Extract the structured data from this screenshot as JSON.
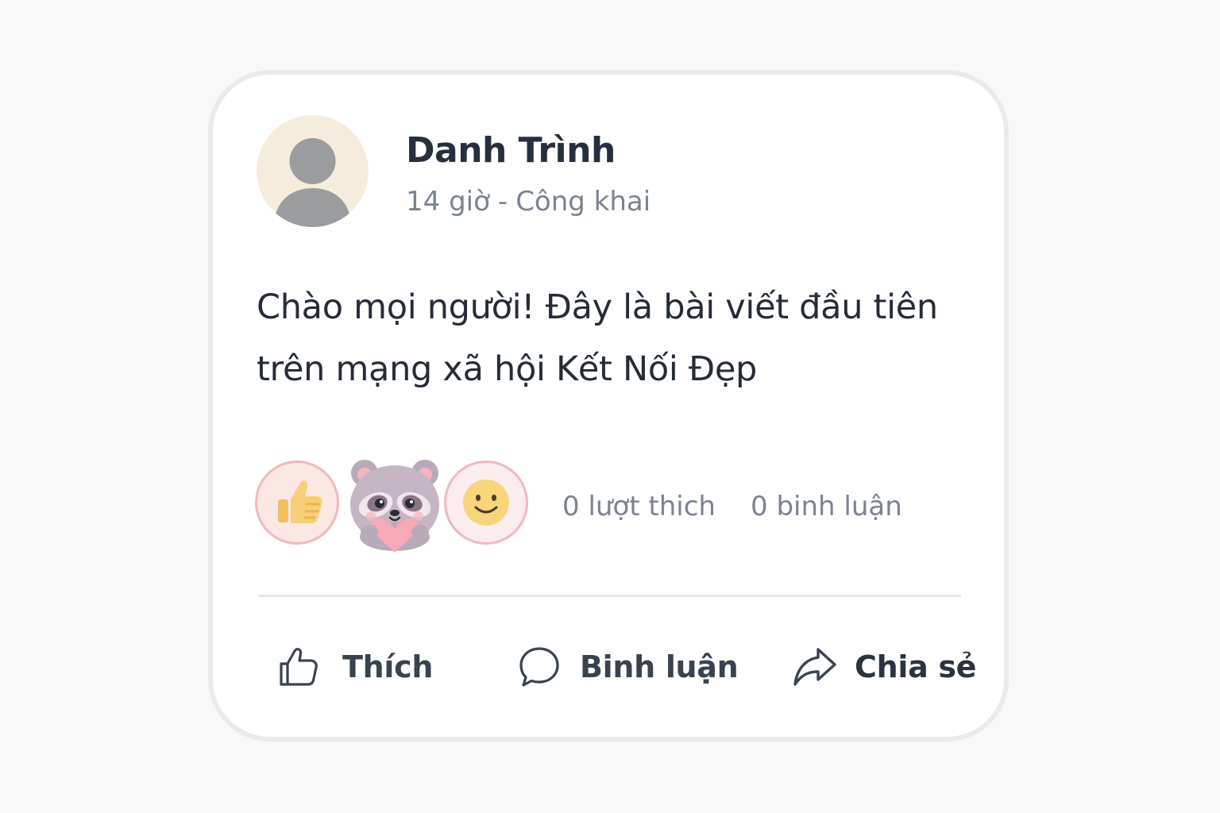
{
  "post": {
    "author": {
      "name": "Danh Trình",
      "avatar_icon": "default-user-icon"
    },
    "meta": {
      "time": "14 giờ",
      "separator": "-",
      "privacy": "Công khai"
    },
    "content": "Chào mọi người! Đây là bài viết đầu tiên trên mạng xã hội Kết Nối Đẹp"
  },
  "reactions": [
    {
      "icon": "thumbs-up-icon"
    },
    {
      "icon": "raccoon-heart-sticker-icon"
    },
    {
      "icon": "smile-face-icon"
    }
  ],
  "stats": {
    "likes": "0 lượt thich",
    "comments": "0 binh luận"
  },
  "actions": {
    "like": {
      "label": "Thích",
      "icon": "thumbs-up-outline-icon"
    },
    "comment": {
      "label": "Binh luận",
      "icon": "speech-bubble-icon"
    },
    "share": {
      "label": "Chia sẻ",
      "icon": "share-arrow-icon"
    }
  },
  "colors": {
    "avatar_bg": "#f6ecdd",
    "reaction_ring": "#f3b8bf",
    "text_primary": "#262f3e",
    "text_secondary": "#7b8390"
  }
}
